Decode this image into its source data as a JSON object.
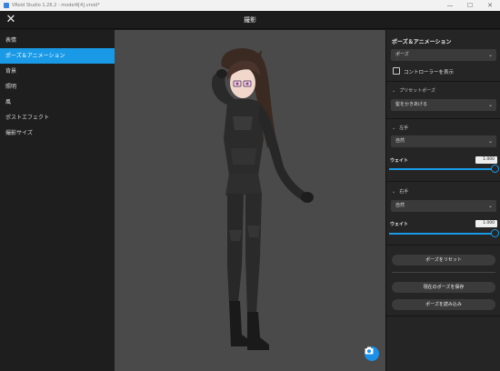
{
  "window": {
    "title": "VRoid Studio 1.26.2 - model4[4].vroid*",
    "minimize": "—",
    "maximize": "☐",
    "close": "✕"
  },
  "header": {
    "close_glyph": "✕",
    "title": "撮影"
  },
  "sidebar": {
    "items": [
      {
        "label": "表情"
      },
      {
        "label": "ポーズ＆アニメーション",
        "active": true
      },
      {
        "label": "背景"
      },
      {
        "label": "照明"
      },
      {
        "label": "風"
      },
      {
        "label": "ポストエフェクト"
      },
      {
        "label": "撮影サイズ"
      }
    ]
  },
  "viewport": {
    "camera_icon": "camera-icon"
  },
  "panel": {
    "title": "ポーズ＆アニメーション",
    "mode_select": "ポーズ",
    "show_controller": "コントローラーを表示",
    "preset_pose": {
      "heading": "プリセットポーズ",
      "value": "髪をかきあげる"
    },
    "left_hand": {
      "heading": "左手",
      "value": "自然",
      "weight_label": "ウェイト",
      "weight": "1.000",
      "weight_level": 1.0
    },
    "right_hand": {
      "heading": "右手",
      "value": "自然",
      "weight_label": "ウェイト",
      "weight": "1.000",
      "weight_level": 1.0
    },
    "reset_button": "ポーズをリセット",
    "save_button": "現在のポーズを保存",
    "load_button": "ポーズを読み込み"
  },
  "colors": {
    "accent": "#1a9ae6",
    "sidebar_bg": "#1e1e1e",
    "panel_bg": "#252525",
    "viewport_bg": "#4a4a4a"
  }
}
